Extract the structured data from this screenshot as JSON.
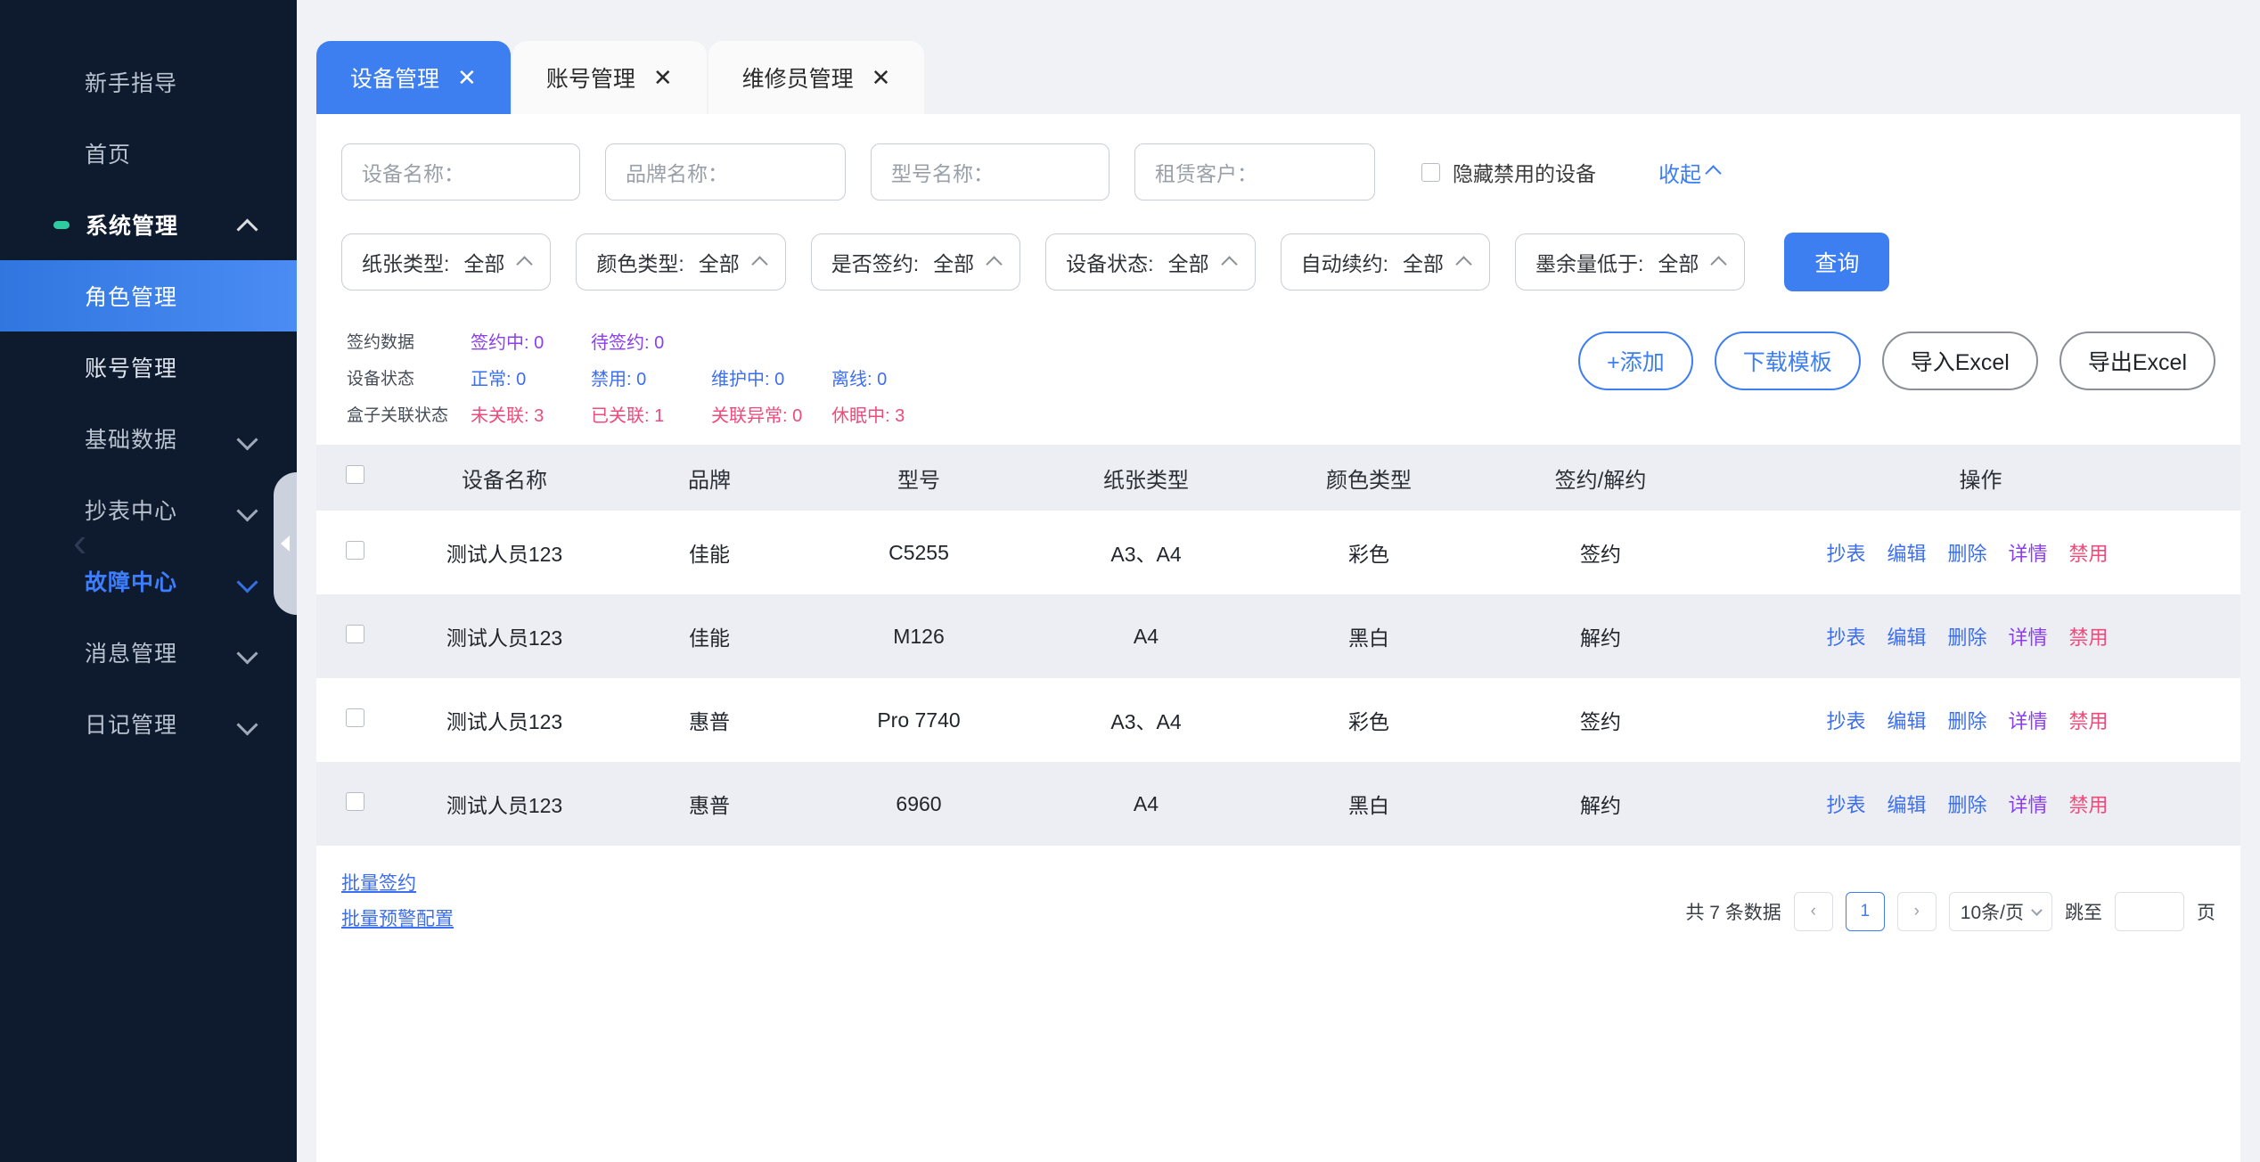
{
  "sidebar": {
    "items": [
      {
        "label": "新手指导",
        "type": "plain",
        "expandable": false
      },
      {
        "label": "首页",
        "type": "plain",
        "expandable": false
      },
      {
        "label": "系统管理",
        "type": "group",
        "expandable": true,
        "state": "expanded",
        "dot": true
      },
      {
        "label": "角色管理",
        "type": "sub",
        "active": true
      },
      {
        "label": "账号管理",
        "type": "sub",
        "active": false
      },
      {
        "label": "基础数据",
        "type": "group-collapsed",
        "expandable": true,
        "state": "collapsed"
      },
      {
        "label": "抄表中心",
        "type": "group-collapsed",
        "expandable": true,
        "state": "collapsed"
      },
      {
        "label": "故障中心",
        "type": "group-accent",
        "expandable": true,
        "state": "collapsed"
      },
      {
        "label": "消息管理",
        "type": "group-collapsed",
        "expandable": true,
        "state": "collapsed"
      },
      {
        "label": "日记管理",
        "type": "group-collapsed",
        "expandable": true,
        "state": "collapsed"
      }
    ],
    "collapse_handle": "collapse-sidebar"
  },
  "tabs": [
    {
      "label": "设备管理",
      "close": "✕",
      "active": true
    },
    {
      "label": "账号管理",
      "close": "✕",
      "active": false
    },
    {
      "label": "维修员管理",
      "close": "✕",
      "active": false
    }
  ],
  "filters": {
    "text_fields": [
      {
        "name": "device-name",
        "placeholder": "设备名称：",
        "value": ""
      },
      {
        "name": "brand-name",
        "placeholder": "品牌名称：",
        "value": ""
      },
      {
        "name": "model-name",
        "placeholder": "型号名称：",
        "value": ""
      },
      {
        "name": "rental-customer",
        "placeholder": "租赁客户：",
        "value": ""
      }
    ],
    "hide_disabled_label": "隐藏禁用的设备",
    "hide_disabled_checked": false,
    "collapse_label": "收起",
    "selects": [
      {
        "name": "paper-type",
        "label": "纸张类型:",
        "value": "全部"
      },
      {
        "name": "color-type",
        "label": "颜色类型:",
        "value": "全部"
      },
      {
        "name": "is-signed",
        "label": "是否签约:",
        "value": "全部"
      },
      {
        "name": "device-status",
        "label": "设备状态:",
        "value": "全部"
      },
      {
        "name": "auto-renew",
        "label": "自动续约:",
        "value": "全部"
      },
      {
        "name": "ink-below",
        "label": "墨余量低于:",
        "value": "全部"
      }
    ],
    "search_button": "查询"
  },
  "stats": [
    {
      "label": "签约数据",
      "color_class": "c1",
      "items": [
        {
          "text": "签约中: 0"
        },
        {
          "text": "待签约: 0"
        }
      ]
    },
    {
      "label": "设备状态",
      "color_class": "c2",
      "items": [
        {
          "text": "正常: 0"
        },
        {
          "text": "禁用: 0"
        },
        {
          "text": "维护中: 0"
        },
        {
          "text": "离线: 0"
        }
      ]
    },
    {
      "label": "盒子关联状态",
      "color_class": "c3",
      "items": [
        {
          "text": "未关联: 3"
        },
        {
          "text": "已关联: 1"
        },
        {
          "text": "关联异常: 0"
        },
        {
          "text": "休眠中: 3"
        }
      ]
    }
  ],
  "actions": [
    {
      "label": "+添加",
      "style": "primary-outline"
    },
    {
      "label": "下载模板",
      "style": "primary-outline"
    },
    {
      "label": "导入Excel",
      "style": "plain-outline"
    },
    {
      "label": "导出Excel",
      "style": "plain-outline"
    }
  ],
  "table": {
    "columns": [
      "",
      "设备名称",
      "品牌",
      "型号",
      "纸张类型",
      "颜色类型",
      "签约/解约",
      "操作"
    ],
    "ops_labels": [
      "抄表",
      "编辑",
      "删除",
      "详情",
      "禁用"
    ],
    "rows": [
      {
        "name": "测试人员123",
        "brand": "佳能",
        "model": "C5255",
        "paper": "A3、A4",
        "color": "彩色",
        "sign": "签约",
        "sign_state": "yes"
      },
      {
        "name": "测试人员123",
        "brand": "佳能",
        "model": "M126",
        "paper": "A4",
        "color": "黑白",
        "sign": "解约",
        "sign_state": "no"
      },
      {
        "name": "测试人员123",
        "brand": "惠普",
        "model": "Pro 7740",
        "paper": "A3、A4",
        "color": "彩色",
        "sign": "签约",
        "sign_state": "yes"
      },
      {
        "name": "测试人员123",
        "brand": "惠普",
        "model": "6960",
        "paper": "A4",
        "color": "黑白",
        "sign": "解约",
        "sign_state": "no"
      }
    ]
  },
  "footer": {
    "bulk_links": [
      "批量签约",
      "批量预警配置"
    ],
    "pagination": {
      "total_text": "共 7 条数据",
      "prev": "‹",
      "current_page": "1",
      "next": "›",
      "page_size": "10条/页",
      "jump_label": "跳至",
      "jump_value": "",
      "page_unit": "页"
    }
  },
  "colors": {
    "accent": "#3d7ef0",
    "sidebar_bg": "#0e1b2e",
    "sign_yes": "#ef4a7b",
    "sign_no": "#4cc07a",
    "purple": "#8a3ff0"
  }
}
